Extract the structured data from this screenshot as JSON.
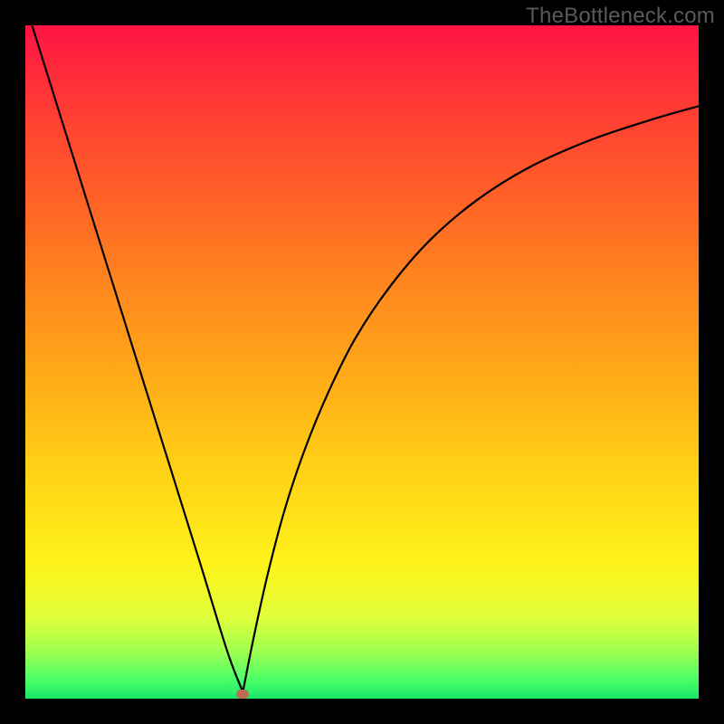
{
  "watermark": {
    "text": "TheBottleneck.com"
  },
  "marker": {
    "color": "#bd6a55",
    "x_frac": 0.323,
    "y_frac": 0.993
  },
  "chart_data": {
    "type": "line",
    "title": "",
    "xlabel": "",
    "ylabel": "",
    "xlim": [
      0,
      1
    ],
    "ylim": [
      0,
      1
    ],
    "grid": false,
    "legend": false,
    "series": [
      {
        "name": "curve-left",
        "x": [
          0.01,
          0.06,
          0.11,
          0.16,
          0.21,
          0.26,
          0.3,
          0.323
        ],
        "y": [
          1.0,
          0.84,
          0.68,
          0.52,
          0.36,
          0.2,
          0.07,
          0.01
        ]
      },
      {
        "name": "curve-right",
        "x": [
          0.323,
          0.34,
          0.36,
          0.385,
          0.415,
          0.45,
          0.49,
          0.54,
          0.6,
          0.67,
          0.75,
          0.84,
          0.93,
          1.0
        ],
        "y": [
          0.01,
          0.095,
          0.185,
          0.28,
          0.37,
          0.455,
          0.535,
          0.61,
          0.68,
          0.74,
          0.79,
          0.83,
          0.86,
          0.88
        ]
      }
    ],
    "annotations": [
      {
        "type": "marker",
        "x": 0.323,
        "y": 0.007,
        "color": "#bd6a55"
      }
    ],
    "background_gradient": {
      "orientation": "vertical",
      "stops": [
        {
          "pos": 0.0,
          "color": "#ff1344"
        },
        {
          "pos": 0.12,
          "color": "#ff3b34"
        },
        {
          "pos": 0.25,
          "color": "#ff5f28"
        },
        {
          "pos": 0.38,
          "color": "#ff851e"
        },
        {
          "pos": 0.52,
          "color": "#ffaa18"
        },
        {
          "pos": 0.66,
          "color": "#ffd116"
        },
        {
          "pos": 0.8,
          "color": "#fff21a"
        },
        {
          "pos": 0.88,
          "color": "#dfff3a"
        },
        {
          "pos": 0.93,
          "color": "#9fff50"
        },
        {
          "pos": 0.97,
          "color": "#4fff68"
        },
        {
          "pos": 1.0,
          "color": "#18e86a"
        }
      ]
    }
  }
}
